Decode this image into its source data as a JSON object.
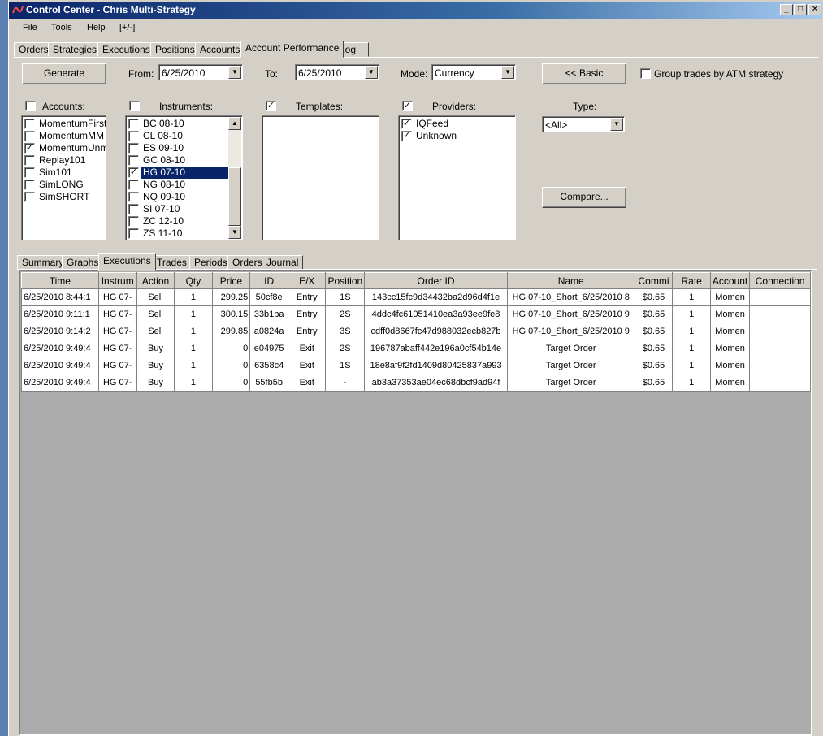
{
  "window": {
    "title": "Control Center - Chris Multi-Strategy",
    "minimize": "_",
    "maximize": "□",
    "close": "✕"
  },
  "menu": [
    "File",
    "Tools",
    "Help",
    "[+/-]"
  ],
  "main_tabs": [
    "Orders",
    "Strategies",
    "Executions",
    "Positions",
    "Accounts",
    "Account Performance",
    "Log"
  ],
  "main_tabs_active": "Account Performance",
  "toolbar": {
    "generate_label": "Generate",
    "from_label": "From:",
    "from_value": "6/25/2010",
    "to_label": "To:",
    "to_value": "6/25/2010",
    "mode_label": "Mode:",
    "mode_value": "Currency",
    "basic_label": "<< Basic",
    "group_trades_label": "Group trades by ATM strategy",
    "group_trades_checked": false
  },
  "filters": {
    "accounts": {
      "label": "Accounts:",
      "checked": false,
      "items": [
        {
          "text": "MomentumFirst",
          "checked": false
        },
        {
          "text": "MomentumMM",
          "checked": false
        },
        {
          "text": "MomentumUnmar",
          "checked": true
        },
        {
          "text": "Replay101",
          "checked": false
        },
        {
          "text": "Sim101",
          "checked": false
        },
        {
          "text": "SimLONG",
          "checked": false
        },
        {
          "text": "SimSHORT",
          "checked": false
        }
      ]
    },
    "instruments": {
      "label": "Instruments:",
      "checked": false,
      "items": [
        {
          "text": "BC 08-10",
          "checked": false
        },
        {
          "text": "CL 08-10",
          "checked": false
        },
        {
          "text": "ES 09-10",
          "checked": false
        },
        {
          "text": "GC 08-10",
          "checked": false
        },
        {
          "text": "HG 07-10",
          "checked": true,
          "selected": true
        },
        {
          "text": "NG 08-10",
          "checked": false
        },
        {
          "text": "NQ 09-10",
          "checked": false
        },
        {
          "text": "SI 07-10",
          "checked": false
        },
        {
          "text": "ZC 12-10",
          "checked": false
        },
        {
          "text": "ZS 11-10",
          "checked": false
        }
      ]
    },
    "templates": {
      "label": "Templates:",
      "checked": true,
      "items": []
    },
    "providers": {
      "label": "Providers:",
      "checked": true,
      "items": [
        {
          "text": "IQFeed",
          "checked": true
        },
        {
          "text": "Unknown",
          "checked": true
        }
      ]
    },
    "type": {
      "label": "Type:",
      "value": "<All>"
    },
    "compare_label": "Compare..."
  },
  "sub_tabs": [
    "Summary",
    "Graphs",
    "Executions",
    "Trades",
    "Periods",
    "Orders",
    "Journal"
  ],
  "sub_tabs_active": "Executions",
  "grid": {
    "columns": [
      "Time",
      "Instrum",
      "Action",
      "Qty",
      "Price",
      "ID",
      "E/X",
      "Position",
      "Order ID",
      "Name",
      "Commi",
      "Rate",
      "Account",
      "Connection"
    ],
    "rows": [
      [
        "6/25/2010 8:44:1",
        "HG 07-",
        "Sell",
        "1",
        "299.25",
        "50cf8e",
        "Entry",
        "1S",
        "143cc15fc9d34432ba2d96d4f1e",
        "HG 07-10_Short_6/25/2010 8",
        "$0.65",
        "1",
        "Momen",
        ""
      ],
      [
        "6/25/2010 9:11:1",
        "HG 07-",
        "Sell",
        "1",
        "300.15",
        "33b1ba",
        "Entry",
        "2S",
        "4ddc4fc61051410ea3a93ee9fe8",
        "HG 07-10_Short_6/25/2010 9",
        "$0.65",
        "1",
        "Momen",
        ""
      ],
      [
        "6/25/2010 9:14:2",
        "HG 07-",
        "Sell",
        "1",
        "299.85",
        "a0824a",
        "Entry",
        "3S",
        "cdff0d8667fc47d988032ecb827b",
        "HG 07-10_Short_6/25/2010 9",
        "$0.65",
        "1",
        "Momen",
        ""
      ],
      [
        "6/25/2010 9:49:4",
        "HG 07-",
        "Buy",
        "1",
        "0",
        "e04975",
        "Exit",
        "2S",
        "196787abaff442e196a0cf54b14e",
        "Target Order",
        "$0.65",
        "1",
        "Momen",
        ""
      ],
      [
        "6/25/2010 9:49:4",
        "HG 07-",
        "Buy",
        "1",
        "0",
        "6358c4",
        "Exit",
        "1S",
        "18e8af9f2fd1409d80425837a993",
        "Target Order",
        "$0.65",
        "1",
        "Momen",
        ""
      ],
      [
        "6/25/2010 9:49:4",
        "HG 07-",
        "Buy",
        "1",
        "0",
        "55fb5b",
        "Exit",
        "-",
        "ab3a37353ae04ec68dbcf9ad94f",
        "Target Order",
        "$0.65",
        "1",
        "Momen",
        ""
      ]
    ]
  },
  "colors": {
    "titlebar_start": "#0a246a",
    "titlebar_end": "#a6caf0",
    "face": "#d4d0c8",
    "selection": "#0a246a",
    "grid_empty": "#ababab"
  }
}
